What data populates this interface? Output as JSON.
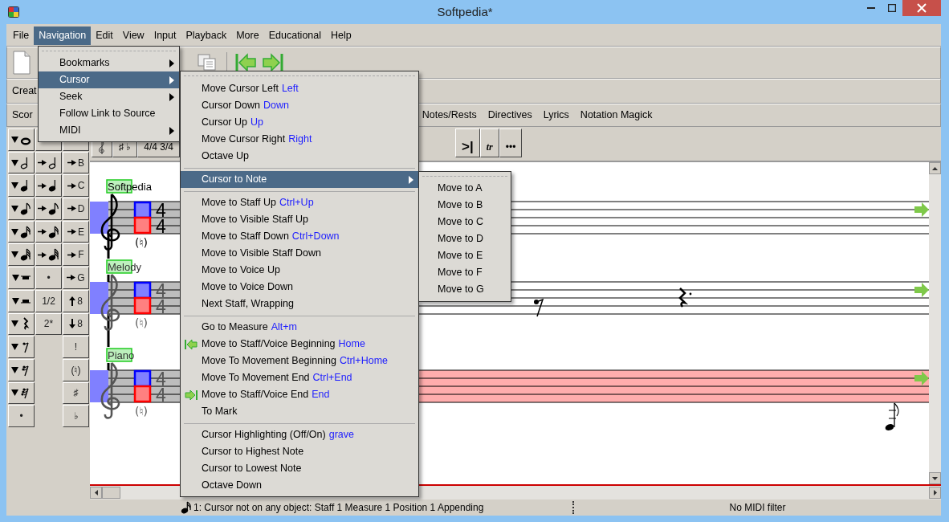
{
  "window": {
    "title": "Softpedia*"
  },
  "menubar": [
    {
      "label": "File",
      "selected": false
    },
    {
      "label": "Navigation",
      "selected": true
    },
    {
      "label": "Edit",
      "selected": false
    },
    {
      "label": "View",
      "selected": false
    },
    {
      "label": "Input",
      "selected": false
    },
    {
      "label": "Playback",
      "selected": false
    },
    {
      "label": "More",
      "selected": false
    },
    {
      "label": "Educational",
      "selected": false
    },
    {
      "label": "Help",
      "selected": false
    }
  ],
  "navigation_menu": [
    {
      "label": "Bookmarks",
      "submenu": true,
      "selected": false
    },
    {
      "label": "Cursor",
      "submenu": true,
      "selected": true
    },
    {
      "label": "Seek",
      "submenu": true,
      "selected": false
    },
    {
      "label": "Follow Link to Source",
      "submenu": false,
      "selected": false
    },
    {
      "label": "MIDI",
      "submenu": true,
      "selected": false
    }
  ],
  "cursor_menu": [
    [
      {
        "label": "Move Cursor Left",
        "shortcut": "Left"
      },
      {
        "label": "Cursor Down",
        "shortcut": "Down"
      },
      {
        "label": "Cursor Up",
        "shortcut": "Up"
      },
      {
        "label": "Move Cursor Right",
        "shortcut": "Right"
      },
      {
        "label": "Octave Up"
      }
    ],
    [
      {
        "label": "Cursor to Note",
        "submenu": true,
        "selected": true
      }
    ],
    [
      {
        "label": "Move to Staff Up",
        "shortcut": "Ctrl+Up"
      },
      {
        "label": "Move to Visible Staff Up"
      },
      {
        "label": "Move to Staff Down",
        "shortcut": "Ctrl+Down"
      },
      {
        "label": "Move to Visible Staff Down"
      },
      {
        "label": "Move to Voice Up"
      },
      {
        "label": "Move to Voice Down"
      },
      {
        "label": "Next Staff, Wrapping"
      }
    ],
    [
      {
        "label": "Go to Measure",
        "shortcut": "Alt+m"
      },
      {
        "label": "Move to Staff/Voice Beginning",
        "shortcut": "Home",
        "kind": "start"
      },
      {
        "label": "Move To Movement Beginning",
        "shortcut": "Ctrl+Home"
      },
      {
        "label": "Move To Movement End",
        "shortcut": "Ctrl+End"
      },
      {
        "label": "Move to Staff/Voice End",
        "shortcut": "End",
        "kind": "finish"
      },
      {
        "label": "To Mark"
      }
    ],
    [
      {
        "label": "Cursor Highlighting (Off/On)",
        "shortcut": "grave"
      },
      {
        "label": "Cursor to Highest Note"
      },
      {
        "label": "Cursor to Lowest Note"
      },
      {
        "label": "Octave Down"
      }
    ]
  ],
  "note_menu": [
    {
      "label": "Move to A"
    },
    {
      "label": "Move to B"
    },
    {
      "label": "Move to C"
    },
    {
      "label": "Move to D"
    },
    {
      "label": "Move to E"
    },
    {
      "label": "Move to F"
    },
    {
      "label": "Move to G"
    }
  ],
  "create_bar": {
    "label": "Creat"
  },
  "tabs_left": [
    {
      "label": "Scor"
    }
  ],
  "tabs_right": [
    {
      "label": "Notes/Rests"
    },
    {
      "label": "Directives"
    },
    {
      "label": "Lyrics"
    },
    {
      "label": "Notation Magick"
    }
  ],
  "toolbar_left": [
    {
      "kind": "clef"
    },
    {
      "kind": "text",
      "label": "♯ ♭"
    },
    {
      "kind": "text",
      "label": "4/4 3/4"
    }
  ],
  "toolbar_right": [
    {
      "kind": "text",
      "label": ">|"
    },
    {
      "kind": "italic",
      "label": "tr"
    },
    {
      "kind": "text",
      "label": "•••"
    }
  ],
  "palette": [
    [
      {
        "kind": "drop"
      },
      {
        "kind": "blank"
      },
      {
        "kind": "blank"
      }
    ],
    [
      {
        "kind": "drop"
      },
      {
        "kind": "insert"
      },
      {
        "kind": "insert",
        "label": "B"
      }
    ],
    [
      {
        "kind": "drop"
      },
      {
        "kind": "insert"
      },
      {
        "kind": "insert",
        "label": "C"
      }
    ],
    [
      {
        "kind": "drop"
      },
      {
        "kind": "insert"
      },
      {
        "kind": "insert",
        "label": "D"
      }
    ],
    [
      {
        "kind": "drop"
      },
      {
        "kind": "insert"
      },
      {
        "kind": "insert",
        "label": "E"
      }
    ],
    [
      {
        "kind": "drop"
      },
      {
        "kind": "insert"
      },
      {
        "kind": "insert",
        "label": "F"
      }
    ],
    [
      {
        "kind": "drop"
      },
      {
        "kind": "text",
        "label": "•"
      },
      {
        "kind": "insert",
        "label": "G"
      }
    ],
    [
      {
        "kind": "drop"
      },
      {
        "kind": "text",
        "label": "1/2"
      },
      {
        "kind": "octave-up",
        "label": "8"
      }
    ],
    [
      {
        "kind": "drop"
      },
      {
        "kind": "text",
        "label": "2*"
      },
      {
        "kind": "octave-down",
        "label": "8"
      }
    ],
    [
      {
        "kind": "drop"
      },
      {
        "kind": "gap"
      },
      {
        "kind": "text",
        "label": "!"
      }
    ],
    [
      {
        "kind": "drop"
      },
      {
        "kind": "gap"
      },
      {
        "kind": "text",
        "label": "(♮)"
      }
    ],
    [
      {
        "kind": "drop"
      },
      {
        "kind": "gap"
      },
      {
        "kind": "text",
        "label": "♯"
      }
    ],
    [
      {
        "kind": "text",
        "label": "•"
      },
      {
        "kind": "gap"
      },
      {
        "kind": "text",
        "label": "♭"
      }
    ]
  ],
  "score": {
    "staves": [
      {
        "name": "Softpedia",
        "dimmed": false,
        "selected": false,
        "time": [
          "4",
          "4"
        ],
        "accidental": "(♮)"
      },
      {
        "name": "Melody",
        "dimmed": true,
        "selected": false,
        "time": [
          "4",
          "4"
        ],
        "accidental": "(♮)"
      },
      {
        "name": "Piano",
        "dimmed": true,
        "selected": true,
        "time": [
          "4",
          "4"
        ],
        "accidental": "(♮)"
      }
    ]
  },
  "status_bar": {
    "position": "1: Cursor not on any object:  Staff 1 Measure 1 Position 1 Appending",
    "midi": "No MIDI filter"
  }
}
